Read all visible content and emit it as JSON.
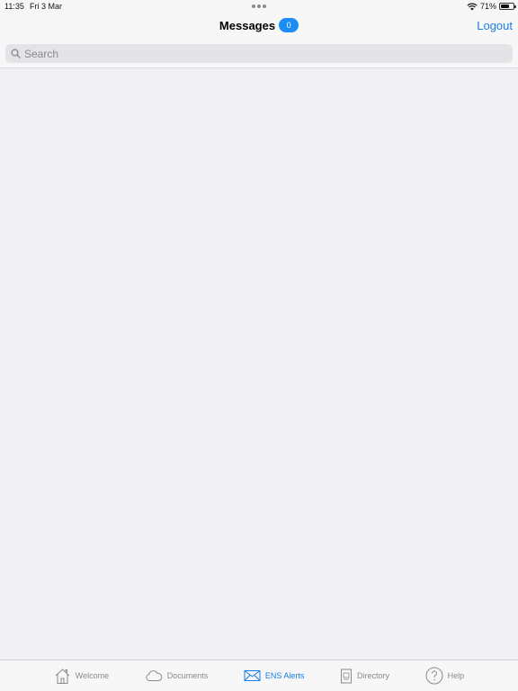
{
  "status_bar": {
    "time": "11:35",
    "date": "Fri 3 Mar",
    "battery_percent": "71%",
    "battery_level": 0.71,
    "icons": [
      "wifi-icon",
      "battery-icon"
    ]
  },
  "nav": {
    "title": "Messages",
    "badge_count": "0",
    "logout_label": "Logout"
  },
  "search": {
    "placeholder": "Search",
    "value": ""
  },
  "tabs": [
    {
      "label": "Welcome",
      "icon": "house-icon",
      "active": false
    },
    {
      "label": "Documents",
      "icon": "cloud-icon",
      "active": false
    },
    {
      "label": "ENS Alerts",
      "icon": "envelope-icon",
      "active": true
    },
    {
      "label": "Directory",
      "icon": "document-icon",
      "active": false
    },
    {
      "label": "Help",
      "icon": "question-icon",
      "active": false
    }
  ],
  "colors": {
    "accent": "#1a7ee6",
    "badge": "#1b8cf2",
    "inactive": "#8a8a8e",
    "content_bg": "#efeff4"
  }
}
